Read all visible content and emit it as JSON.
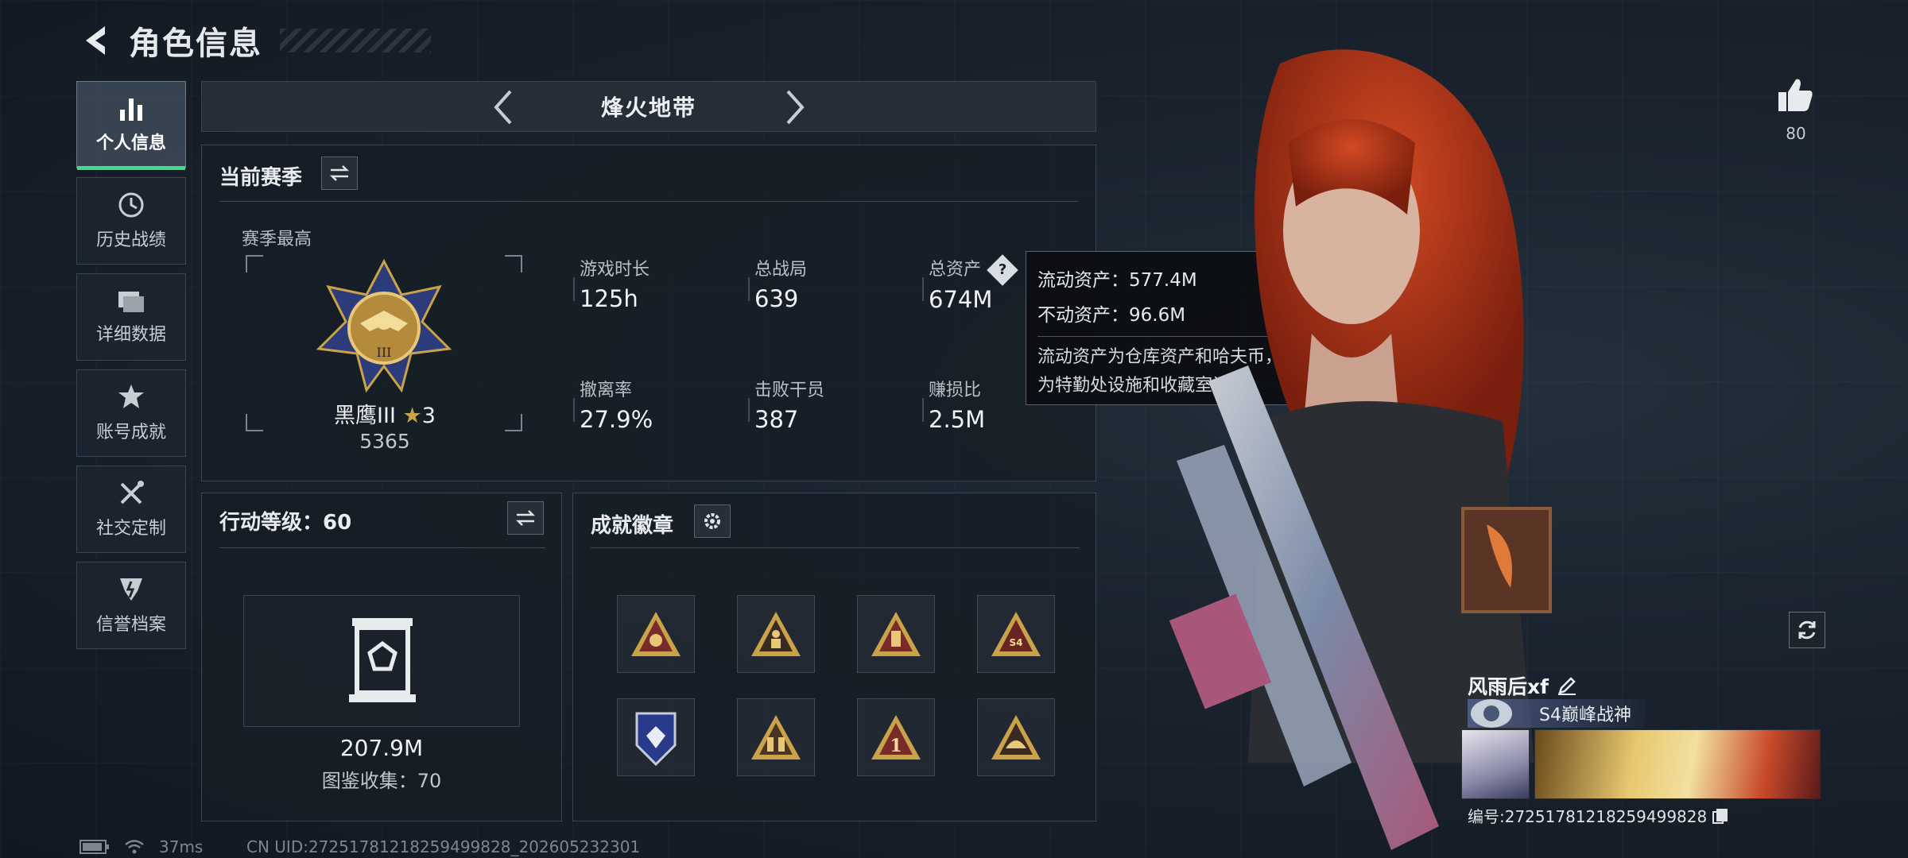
{
  "header": {
    "title": "角色信息"
  },
  "sidenav": {
    "items": [
      {
        "label": "个人信息",
        "icon": "bar-chart-icon",
        "active": true
      },
      {
        "label": "历史战绩",
        "icon": "history-clock-icon"
      },
      {
        "label": "详细数据",
        "icon": "folder-icon"
      },
      {
        "label": "账号成就",
        "icon": "achievement-icon"
      },
      {
        "label": "社交定制",
        "icon": "tools-icon"
      },
      {
        "label": "信誉档案",
        "icon": "reputation-icon"
      }
    ]
  },
  "mode": {
    "label": "烽火地带"
  },
  "season": {
    "title": "当前赛季",
    "subtitle": "赛季最高",
    "rank_name": "黑鹰III",
    "rank_stars": "3",
    "rank_score": "5365",
    "stats": [
      {
        "label": "游戏时长",
        "value": "125h"
      },
      {
        "label": "总战局",
        "value": "639"
      },
      {
        "label": "总资产",
        "value": "674M"
      },
      {
        "label": "撤离率",
        "value": "27.9%"
      },
      {
        "label": "击败干员",
        "value": "387"
      },
      {
        "label": "赚损比",
        "value": "2.5M"
      }
    ]
  },
  "tooltip": {
    "liquid": "流动资产：577.4M",
    "fixed": "不动资产：96.6M",
    "desc_line1": "流动资产为仓库资产和哈夫币，不动资产",
    "desc_line2": "为特勤处设施和收藏室设施"
  },
  "level": {
    "title": "行动等级：60",
    "value": "207.9M",
    "collection": "图鉴收集：70"
  },
  "achievements": {
    "title": "成就徽章",
    "badges": [
      "badge-triangle-emblem",
      "badge-triangle-figure",
      "badge-triangle-canister",
      "badge-triangle-s4",
      "badge-shield-diamond",
      "badge-triangle-soldiers",
      "badge-triangle-number-one",
      "badge-triangle-helmet"
    ]
  },
  "profile": {
    "likes": "80",
    "name": "风雨后xf",
    "title": "S4巅峰战神",
    "id": "编号:27251781218259499828"
  },
  "status": {
    "ping": "37ms",
    "uid": "CN UID:27251781218259499828_202605232301"
  },
  "colors": {
    "accent_green": "#3fdc8a",
    "gold": "#c9a24a"
  }
}
